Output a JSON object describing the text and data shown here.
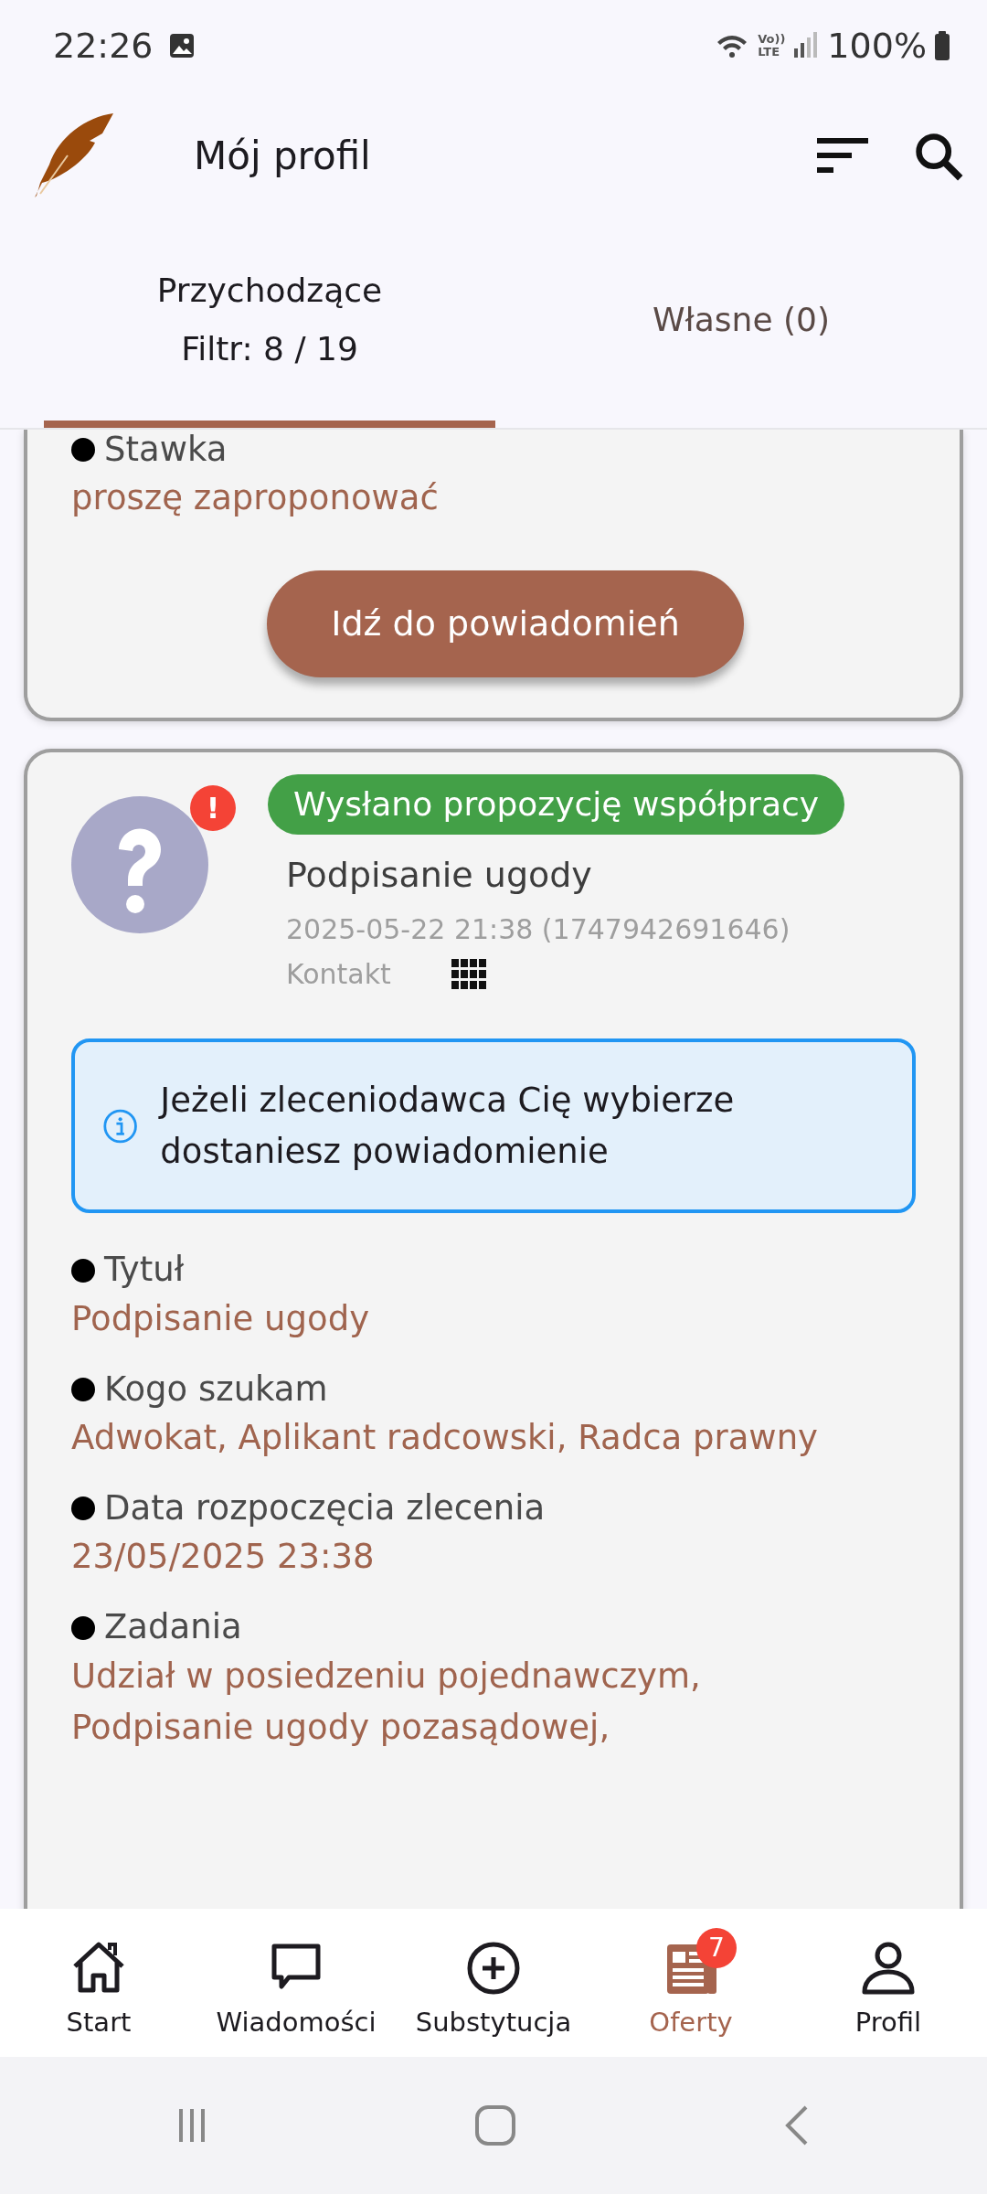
{
  "status_bar": {
    "time": "22:26",
    "network_label": [
      "Vo))",
      "LTE"
    ],
    "battery": "100%"
  },
  "app_bar": {
    "title": "Mój profil"
  },
  "tabs": [
    {
      "label": "Przychodzące",
      "sublabel": "Filtr: 8 / 19",
      "selected": true
    },
    {
      "label": "Własne (0)",
      "selected": false
    }
  ],
  "cards": [
    {
      "kind": "partial",
      "fields": [
        {
          "label": "Stawka",
          "lines": [
            "proszę zaproponować"
          ]
        }
      ],
      "button": "Idź do powiadomień"
    },
    {
      "kind": "full",
      "alert": "!",
      "status": "Wysłano propozycję współpracy",
      "title": "Podpisanie ugody",
      "date": "2025-05-22 21:38 (1747942691646)",
      "contact": "Kontakt",
      "info": "Jeżeli zleceniodawca Cię wybierze dostaniesz powiadomienie",
      "fields": [
        {
          "label": "Tytuł",
          "lines": [
            "Podpisanie ugody"
          ]
        },
        {
          "label": "Kogo szukam",
          "lines": [
            "Adwokat, Aplikant radcowski, Radca prawny"
          ]
        },
        {
          "label": "Data rozpoczęcia zlecenia",
          "lines": [
            "23/05/2025 23:38"
          ]
        },
        {
          "label": "Zadania",
          "lines": [
            "Udział w posiedzeniu pojednawczym,",
            "Podpisanie ugody pozasądowej,"
          ]
        }
      ]
    }
  ],
  "bottom_nav": [
    {
      "kind": "home",
      "label": "Start",
      "selected": false
    },
    {
      "kind": "chat",
      "label": "Wiadomości",
      "selected": false
    },
    {
      "kind": "add",
      "label": "Substytucja",
      "selected": false
    },
    {
      "kind": "news",
      "label": "Oferty",
      "selected": true,
      "badge": "7"
    },
    {
      "kind": "person",
      "label": "Profil",
      "selected": false
    }
  ]
}
